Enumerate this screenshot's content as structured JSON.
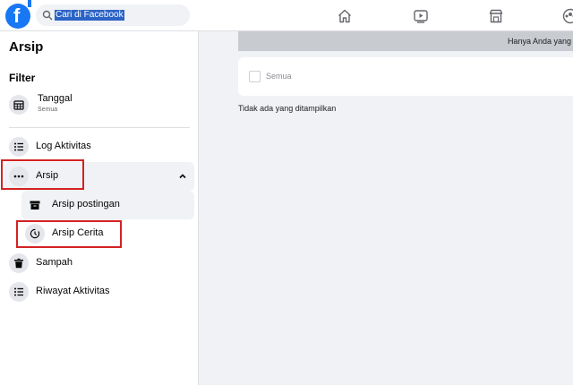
{
  "header": {
    "search_placeholder": "Cari di Facebook",
    "nav_icons": [
      "home-icon",
      "watch-icon",
      "marketplace-icon",
      "groups-icon"
    ],
    "brand_color": "#1877f2"
  },
  "sidebar": {
    "title": "Arsip",
    "filter_label": "Filter",
    "date_filter": {
      "label": "Tanggal",
      "value": "Semua"
    },
    "items": {
      "log": "Log Aktivitas",
      "arsip": "Arsip",
      "arsip_postingan": "Arsip postingan",
      "arsip_cerita": "Arsip Cerita",
      "sampah": "Sampah",
      "riwayat": "Riwayat Aktivitas"
    },
    "highlight_color": "#d32222"
  },
  "main": {
    "banner_text": "Hanya Anda yang",
    "checkbox_label": "Semua",
    "empty_text": "Tidak ada yang ditampilkan"
  }
}
